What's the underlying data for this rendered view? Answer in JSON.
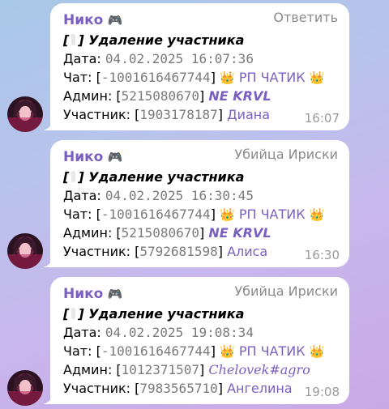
{
  "messages": [
    {
      "sender": "Нико",
      "sender_emoji": "🎮",
      "reply_to": "Ответить",
      "title_open": "[",
      "title_close": "] Удаление участника",
      "date_label": "Дата:",
      "date_value": "04.02.2025 16:07:36",
      "chat_label": "Чат:",
      "chat_open": "[",
      "chat_id": "-1001616467744",
      "chat_close": "]",
      "chat_crown_left": "👑",
      "chat_name": "РП ЧАТИК",
      "chat_crown_right": "👑",
      "admin_label": "Админ:",
      "admin_open": "[",
      "admin_id": "5215080670",
      "admin_close": "]",
      "admin_name": "NE KRVL",
      "member_label": "Участник:",
      "member_open": "[",
      "member_id": "1903178187",
      "member_close": "]",
      "member_name": "Диана",
      "time": "16:07"
    },
    {
      "sender": "Нико",
      "sender_emoji": "🎮",
      "reply_to": "Убийца Ириски",
      "title_open": "[",
      "title_close": "] Удаление участника",
      "date_label": "Дата:",
      "date_value": "04.02.2025 16:30:45",
      "chat_label": "Чат:",
      "chat_open": "[",
      "chat_id": "-1001616467744",
      "chat_close": "]",
      "chat_crown_left": "👑",
      "chat_name": "РП ЧАТИК",
      "chat_crown_right": "👑",
      "admin_label": "Админ:",
      "admin_open": "[",
      "admin_id": "5215080670",
      "admin_close": "]",
      "admin_name": "NE KRVL",
      "member_label": "Участник:",
      "member_open": "[",
      "member_id": "5792681598",
      "member_close": "]",
      "member_name": "Алиса",
      "time": "16:30"
    },
    {
      "sender": "Нико",
      "sender_emoji": "🎮",
      "reply_to": "Убийца Ириски",
      "title_open": "[",
      "title_close": "] Удаление участника",
      "date_label": "Дата:",
      "date_value": "04.02.2025 19:08:34",
      "chat_label": "Чат:",
      "chat_open": "[",
      "chat_id": "-1001616467744",
      "chat_close": "]",
      "chat_crown_left": "👑",
      "chat_name": "РП ЧАТИК",
      "chat_crown_right": "👑",
      "admin_label": "Админ:",
      "admin_open": "[",
      "admin_id": "1012371507",
      "admin_close": "]",
      "admin_name": "Chelovek#agro",
      "member_label": "Участник:",
      "member_open": "[",
      "member_id": "7983565710",
      "member_close": "]",
      "member_name": "Ангелина",
      "time": "19:08"
    }
  ],
  "colors": {
    "accent": "#7a5fc0",
    "bubble": "#ffffff",
    "time": "#9a9a9a",
    "background_top": "#a8c8e8",
    "background_bottom": "#c9a8e6"
  },
  "icons": {
    "avatar": "avatar-anime-girl",
    "sender_badge": "game-controller-icon",
    "crown": "crown-icon"
  }
}
